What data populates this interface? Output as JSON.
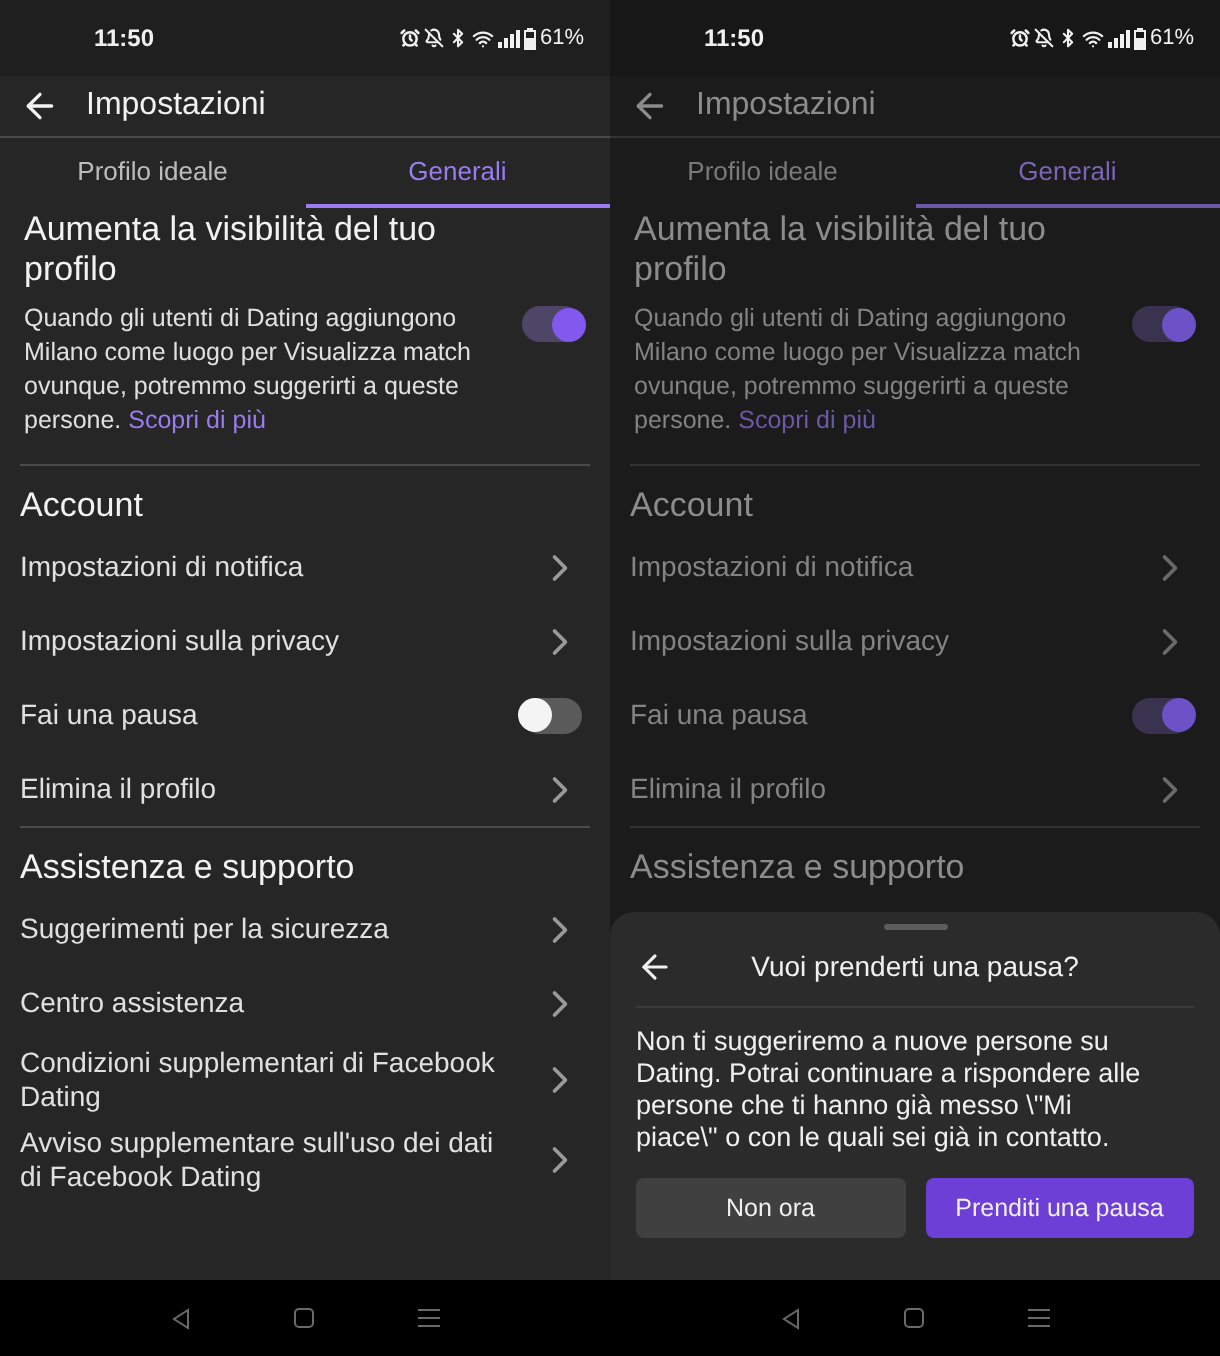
{
  "screens": [
    {
      "dimmed": false,
      "status_bar": {
        "time": "11:50",
        "battery": "61%"
      },
      "header": {
        "title": "Impostazioni"
      },
      "tabs": [
        {
          "label": "Profilo ideale",
          "selected": false
        },
        {
          "label": "Generali",
          "selected": true
        }
      ],
      "visibility": {
        "title": "Aumenta la visibilità del tuo profilo",
        "text": "Quando gli utenti di Dating aggiungono Milano come luogo per Visualizza match ovunque, potremmo suggerirti a queste persone.",
        "link": "Scopri di più",
        "on": true
      },
      "sections": [
        {
          "title": "Account",
          "items": [
            {
              "kind": "link",
              "label": "Impostazioni di notifica"
            },
            {
              "kind": "link",
              "label": "Impostazioni sulla privacy"
            },
            {
              "kind": "toggle",
              "label": "Fai una pausa",
              "on": false
            },
            {
              "kind": "link",
              "label": "Elimina il profilo"
            }
          ]
        },
        {
          "title": "Assistenza e supporto",
          "items": [
            {
              "kind": "link",
              "label": "Suggerimenti per la sicurezza"
            },
            {
              "kind": "link",
              "label": "Centro assistenza"
            },
            {
              "kind": "link",
              "label": "Condizioni supplementari di Facebook Dating"
            },
            {
              "kind": "link",
              "label": "Avviso supplementare sull'uso dei dati di Facebook Dating"
            }
          ]
        }
      ]
    },
    {
      "dimmed": true,
      "status_bar": {
        "time": "11:50",
        "battery": "61%"
      },
      "header": {
        "title": "Impostazioni"
      },
      "tabs": [
        {
          "label": "Profilo ideale",
          "selected": false
        },
        {
          "label": "Generali",
          "selected": true
        }
      ],
      "visibility": {
        "title": "Aumenta la visibilità del tuo profilo",
        "text": "Quando gli utenti di Dating aggiungono Milano come luogo per Visualizza match ovunque, potremmo suggerirti a queste persone.",
        "link": "Scopri di più",
        "on": true
      },
      "sections": [
        {
          "title": "Account",
          "items": [
            {
              "kind": "link",
              "label": "Impostazioni di notifica"
            },
            {
              "kind": "link",
              "label": "Impostazioni sulla privacy"
            },
            {
              "kind": "toggle",
              "label": "Fai una pausa",
              "on": true
            },
            {
              "kind": "link",
              "label": "Elimina il profilo"
            }
          ]
        },
        {
          "title": "Assistenza e supporto"
        }
      ],
      "sheet": {
        "title": "Vuoi prenderti una pausa?",
        "text": "Non ti suggeriremo a nuove persone su Dating. Potrai continuare a rispondere alle persone che ti hanno già messo \\\"Mi piace\\\" o con le quali sei già in contatto.",
        "buttons": [
          {
            "kind": "secondary",
            "label": "Non ora"
          },
          {
            "kind": "primary",
            "label": "Prenditi una pausa"
          }
        ]
      }
    }
  ]
}
